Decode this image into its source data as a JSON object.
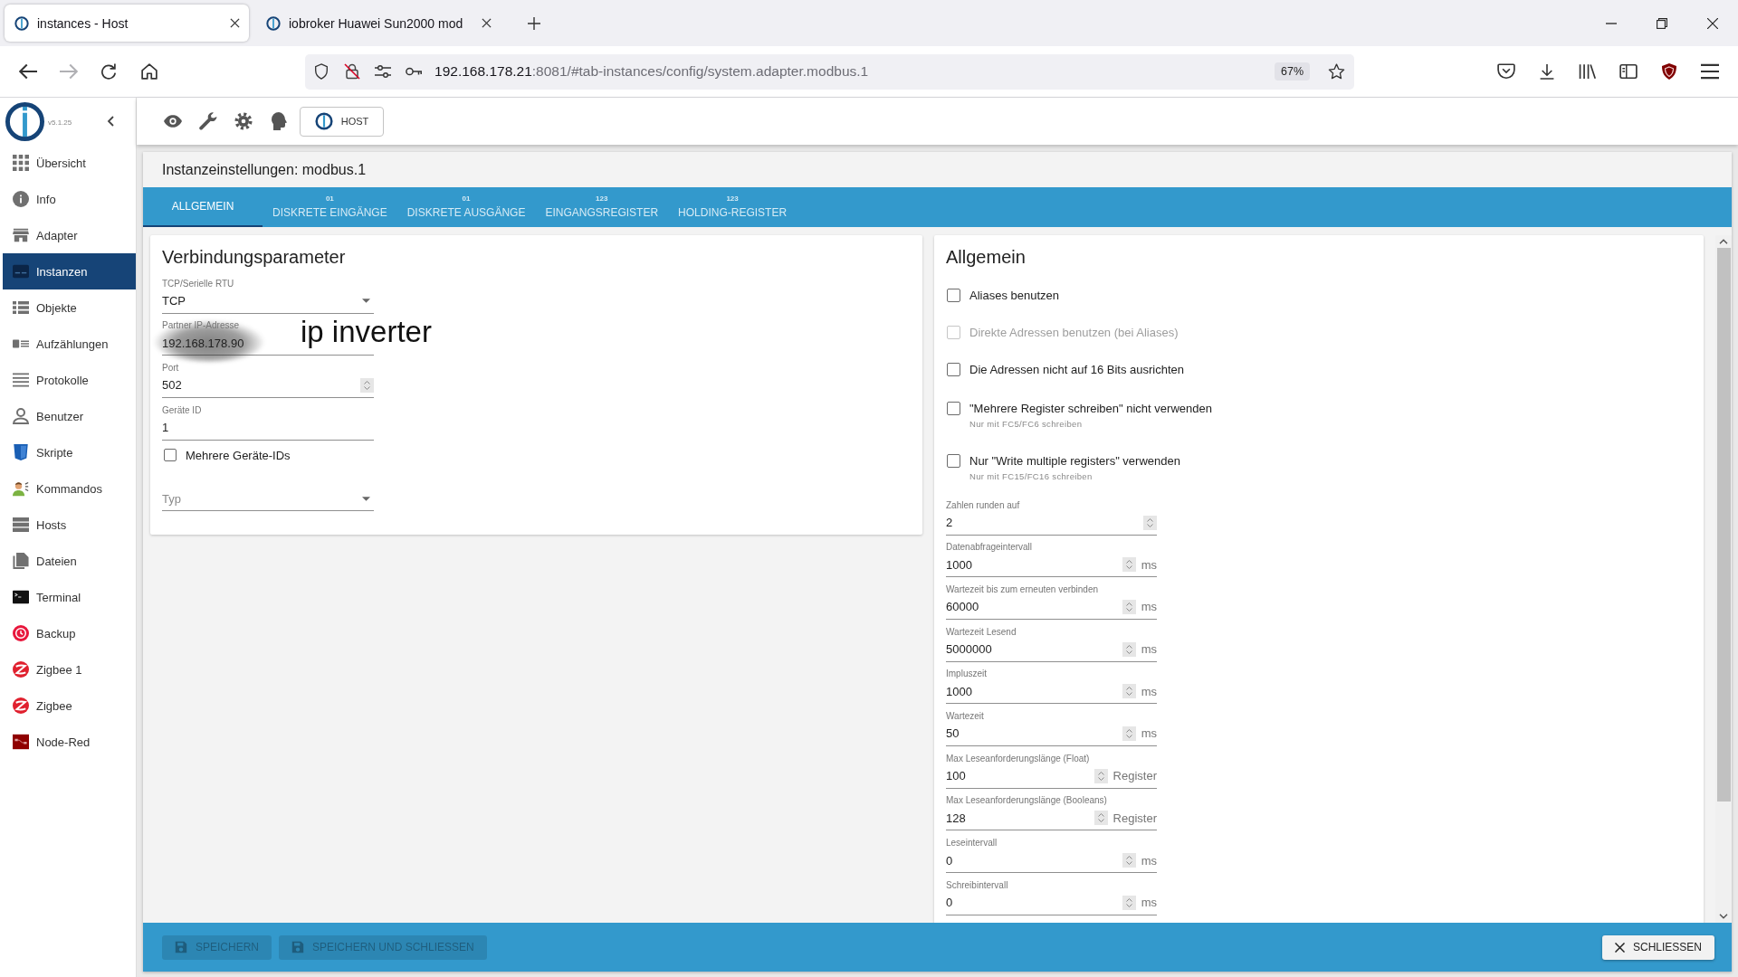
{
  "browser": {
    "tabs": [
      {
        "title": "instances - Host",
        "selected": true
      },
      {
        "title": "iobroker Huawei Sun2000 mod",
        "selected": false
      }
    ],
    "url": {
      "host": "192.168.178.21",
      "rest": ":8081/#tab-instances/config/system.adapter.modbus.1"
    },
    "zoom": "67%"
  },
  "app": {
    "version": "v5.1.25",
    "host_button": "HOST"
  },
  "sidebar": {
    "items": [
      {
        "label": "Übersicht",
        "selected": false
      },
      {
        "label": "Info",
        "selected": false
      },
      {
        "label": "Adapter",
        "selected": false
      },
      {
        "label": "Instanzen",
        "selected": true
      },
      {
        "label": "Objekte",
        "selected": false
      },
      {
        "label": "Aufzählungen",
        "selected": false
      },
      {
        "label": "Protokolle",
        "selected": false
      },
      {
        "label": "Benutzer",
        "selected": false
      },
      {
        "label": "Skripte",
        "selected": false
      },
      {
        "label": "Kommandos",
        "selected": false
      },
      {
        "label": "Hosts",
        "selected": false
      },
      {
        "label": "Dateien",
        "selected": false
      },
      {
        "label": "Terminal",
        "selected": false
      },
      {
        "label": "Backup",
        "selected": false
      },
      {
        "label": "Zigbee 1",
        "selected": false
      },
      {
        "label": "Zigbee",
        "selected": false
      },
      {
        "label": "Node-Red",
        "selected": false
      }
    ]
  },
  "dialog": {
    "title": "Instanzeinstellungen: modbus.1",
    "tabs": [
      {
        "label": "ALLGEMEIN",
        "selected": true
      },
      {
        "badge": "01",
        "label": "DISKRETE EINGÄNGE",
        "selected": false
      },
      {
        "badge": "01",
        "label": "DISKRETE AUSGÄNGE",
        "selected": false
      },
      {
        "badge": "123",
        "label": "EINGANGSREGISTER",
        "selected": false
      },
      {
        "badge": "123",
        "label": "HOLDING-REGISTER",
        "selected": false
      }
    ],
    "connection": {
      "title": "Verbindungsparameter",
      "fields": [
        {
          "kind": "select",
          "label": "TCP/Serielle RTU",
          "value": "TCP"
        },
        {
          "kind": "text",
          "label": "Partner IP-Adresse",
          "value": "192.168.178.90",
          "redacted": true
        },
        {
          "kind": "number",
          "label": "Port",
          "value": "502"
        },
        {
          "kind": "text",
          "label": "Geräte ID",
          "value": "1"
        },
        {
          "kind": "checkbox",
          "label": "Mehrere Geräte-IDs",
          "checked": false
        },
        {
          "kind": "select",
          "placeholder": "Typ"
        }
      ],
      "annotation": "ip inverter"
    },
    "general": {
      "title": "Allgemein",
      "options": [
        {
          "label": "Aliases benutzen",
          "checked": false,
          "disabled": false
        },
        {
          "label": "Direkte Adressen benutzen (bei Aliases)",
          "checked": false,
          "disabled": true
        },
        {
          "label": "Die Adressen nicht auf 16 Bits ausrichten",
          "checked": false,
          "disabled": false
        },
        {
          "label": "\"Mehrere Register schreiben\" nicht verwenden",
          "hint": "Nur mit FC5/FC6 schreiben",
          "checked": false,
          "disabled": false
        },
        {
          "label": "Nur \"Write multiple registers\" verwenden",
          "hint": "Nur mit FC15/FC16 schreiben",
          "checked": false,
          "disabled": false
        }
      ],
      "fields": [
        {
          "label": "Zahlen runden auf",
          "value": "2"
        },
        {
          "label": "Datenabfrageintervall",
          "value": "1000",
          "unit": "ms"
        },
        {
          "label": "Wartezeit bis zum erneuten verbinden",
          "value": "60000",
          "unit": "ms"
        },
        {
          "label": "Wartezeit Lesend",
          "value": "5000000",
          "unit": "ms"
        },
        {
          "label": "Impluszeit",
          "value": "1000",
          "unit": "ms"
        },
        {
          "label": "Wartezeit",
          "value": "50",
          "unit": "ms"
        },
        {
          "label": "Max Leseanforderungslänge (Float)",
          "value": "100",
          "unit": "Register"
        },
        {
          "label": "Max Leseanforderungslänge (Booleans)",
          "value": "128",
          "unit": "Register"
        },
        {
          "label": "Leseintervall",
          "value": "0",
          "unit": "ms"
        },
        {
          "label": "Schreibintervall",
          "value": "0",
          "unit": "ms"
        }
      ]
    },
    "buttons": [
      {
        "label": "SPEICHERN",
        "disabled": true
      },
      {
        "label": "SPEICHERN UND SCHLIESSEN",
        "disabled": true
      }
    ],
    "close_button": "SCHLIESSEN"
  }
}
